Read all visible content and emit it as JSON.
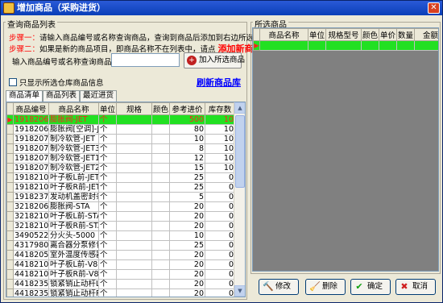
{
  "window": {
    "title": "增加商品（采购进货）"
  },
  "left": {
    "group_title": "查询商品列表",
    "step1": {
      "tag": "步骤一：",
      "text": "请输入商品编号或名称查询商品，查询到商品后添加到右边所选商品"
    },
    "step2": {
      "tag": "步骤二：",
      "text": "如果是新的商品项目，即商品名称不在列表中，请点",
      "link": "添加新商品"
    },
    "input_label": "输入商品编号或名称查询商品：",
    "input_value": "",
    "add_button": "加入所选商品",
    "checkbox_label": "只显示所选仓库商品信息",
    "refresh_link": "刷新商品库",
    "tabs": [
      "商品清单",
      "商品列表",
      "最近进货"
    ],
    "columns": [
      "商品编号",
      "商品名称",
      "单位",
      "规格",
      "颜色",
      "参考进价",
      "库存数"
    ],
    "rows": [
      [
        "191820678",
        "膨胀阀-JET",
        "个",
        "",
        "",
        "500",
        "10"
      ],
      [
        "191820679",
        "膨胀阀[空调]-JE",
        "个",
        "",
        "",
        "80",
        "10"
      ],
      [
        "191820721",
        "制冷软管-JET",
        "个",
        "",
        "",
        "10",
        "10"
      ],
      [
        "191820742",
        "制冷软管-JET3",
        "个",
        "",
        "",
        "8",
        "10"
      ],
      [
        "191820742",
        "制冷软管-JET1",
        "个",
        "",
        "",
        "12",
        "10"
      ],
      [
        "191820743",
        "制冷软管-JET2",
        "个",
        "",
        "",
        "15",
        "10"
      ],
      [
        "191821021",
        "叶子板L前-JET",
        "个",
        "",
        "",
        "25",
        "0"
      ],
      [
        "191821022",
        "叶子板R前-JET",
        "个",
        "",
        "",
        "25",
        "0"
      ],
      [
        "191823737",
        "发动机盖密封条-",
        "个",
        "",
        "",
        "5",
        "0"
      ],
      [
        "321820679",
        "膨胀阀-STA",
        "个",
        "",
        "",
        "20",
        "0"
      ],
      [
        "321821021",
        "叶子板L前-STA",
        "个",
        "",
        "",
        "20",
        "0"
      ],
      [
        "321821022",
        "叶子板R前-STA",
        "个",
        "",
        "",
        "20",
        "0"
      ],
      [
        "34905225",
        "分火头-5000",
        "个",
        "",
        "",
        "10",
        "0"
      ],
      [
        "431798046",
        "离合器分泵修包-",
        "个",
        "",
        "",
        "25",
        "0"
      ],
      [
        "441820541",
        "室外温度传感器-",
        "个",
        "",
        "",
        "20",
        "0"
      ],
      [
        "441821031",
        "叶子板L前-V8",
        "个",
        "",
        "",
        "20",
        "0"
      ],
      [
        "441821032",
        "叶子板R前-V8",
        "个",
        "",
        "",
        "20",
        "0"
      ],
      [
        "441823589",
        "锁紧销止动杆L-V",
        "个",
        "",
        "",
        "20",
        "0"
      ],
      [
        "441823590",
        "锁紧销止动杆R-V",
        "个",
        "",
        "",
        "20",
        "0"
      ]
    ]
  },
  "right": {
    "group_title": "所选商品",
    "columns": [
      "商品名称",
      "单位",
      "规格型号",
      "颜色",
      "单价",
      "数量",
      "金额"
    ],
    "buttons": {
      "edit": "修改",
      "delete": "删除",
      "ok": "确定",
      "cancel": "取消"
    }
  },
  "colors": {
    "selected_row_bg": "#22e022",
    "selected_row_fg": "#ff2020",
    "step_tag": "#ff0000",
    "link": "#0000ff"
  }
}
